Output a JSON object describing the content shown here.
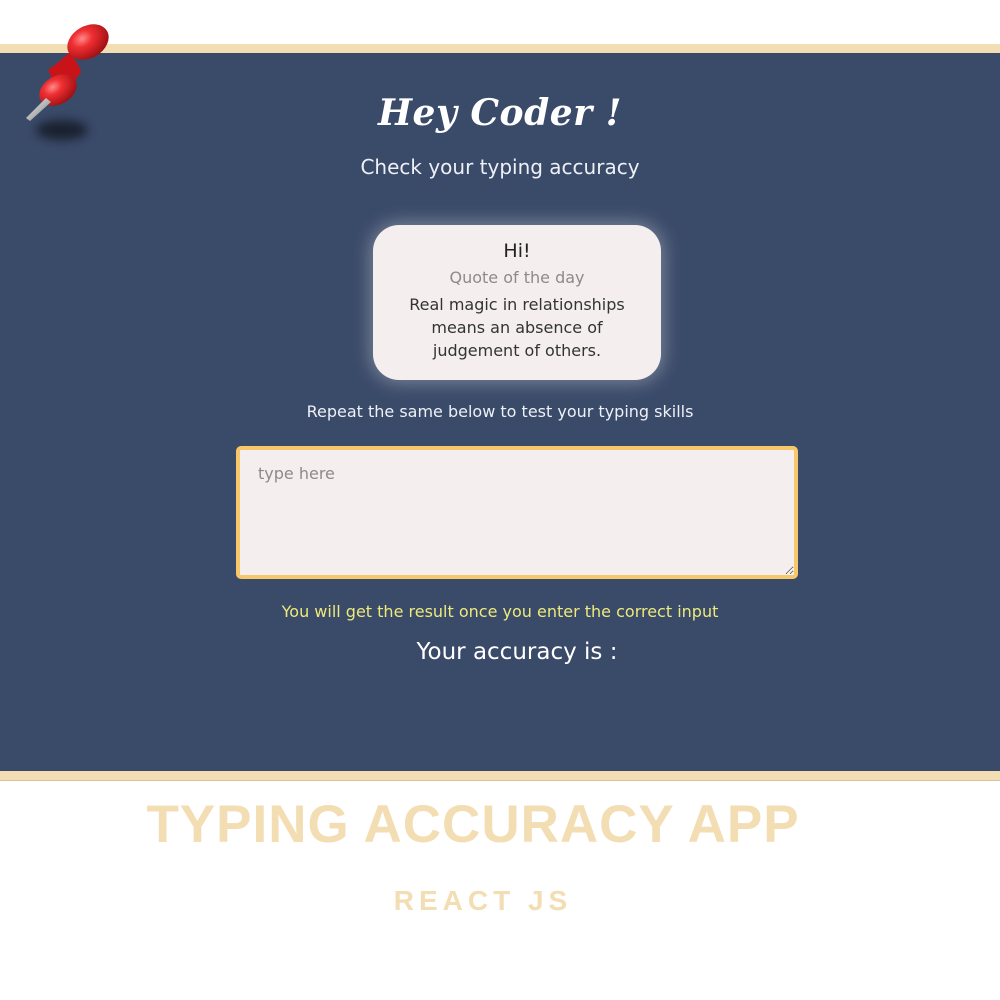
{
  "app": {
    "title": "Hey Coder !",
    "subtitle": "Check your typing accuracy",
    "quote_card": {
      "greeting": "Hi!",
      "label": "Quote of the day",
      "quote": "Real magic in relationships means an absence of judgement of others."
    },
    "repeat_instruction": "Repeat the same below to test your typing skills",
    "typing_input": {
      "value": "",
      "placeholder": "type here"
    },
    "result_hint": "You will get the result once you enter the correct input",
    "accuracy_label": "Your accuracy is :"
  },
  "promo": {
    "title": "TYPING ACCURACY APP",
    "subtitle": "REACT JS"
  },
  "icons": {
    "pin": "pushpin-icon"
  },
  "colors": {
    "app_background": "#3a4a69",
    "border_accent": "#f3ddb2",
    "card_background": "#f4efee",
    "input_border": "#f7c86b",
    "hint_text": "#edea7b"
  }
}
